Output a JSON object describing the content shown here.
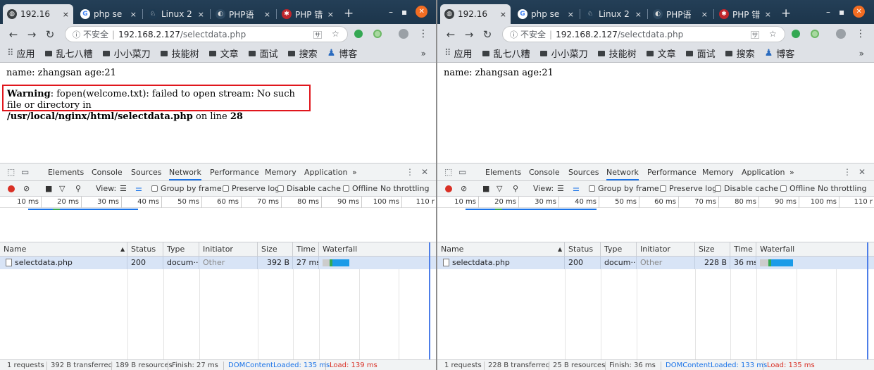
{
  "windows": [
    {
      "tabs": [
        {
          "title": "192.16",
          "close": "×"
        },
        {
          "title": "php se",
          "close": "×"
        },
        {
          "title": "Linux 2",
          "close": "×"
        },
        {
          "title": "PHP语",
          "close": "×"
        },
        {
          "title": "PHP 错",
          "close": "×"
        }
      ],
      "new_tab": "+",
      "url": {
        "insecure": "不安全",
        "host": "192.168.2.127",
        "path": "/selectdata.php"
      },
      "bookmarks": [
        "应用",
        "乱七八糟",
        "小小菜刀",
        "技能树",
        "文章",
        "面试",
        "搜索",
        "博客"
      ],
      "bookmarks_more": "»",
      "page": {
        "name_line": "name: zhangsan age:21",
        "warning": {
          "label": "Warning",
          "message": ": fopen(welcome.txt): failed to open stream: No such file or directory in",
          "path": "/usr/local/nginx/html/selectdata.php",
          "on_line": " on line ",
          "line": "28"
        }
      },
      "devtools": {
        "tabs": [
          "Elements",
          "Console",
          "Sources",
          "Network",
          "Performance",
          "Memory",
          "Application"
        ],
        "active_tab": "Network",
        "more_tabs": "»",
        "controls": {
          "view": "View:",
          "group_by_frame": "Group by frame",
          "preserve_log": "Preserve log",
          "disable_cache": "Disable cache",
          "offline": "Offline",
          "throttling": "No throttling"
        },
        "ruler": [
          "10 ms",
          "20 ms",
          "30 ms",
          "40 ms",
          "50 ms",
          "60 ms",
          "70 ms",
          "80 ms",
          "90 ms",
          "100 ms",
          "110 r"
        ],
        "columns": {
          "name": "Name",
          "status": "Status",
          "type": "Type",
          "initiator": "Initiator",
          "size": "Size",
          "time": "Time",
          "waterfall": "Waterfall"
        },
        "rows": [
          {
            "name": "selectdata.php",
            "status": "200",
            "type": "docum···",
            "initiator": "Other",
            "size": "392 B",
            "time": "27 ms"
          }
        ],
        "footer": {
          "requests": "1 requests",
          "transferred": "392 B transferred",
          "resources": "189 B resources",
          "finish": "Finish: 27 ms",
          "dcl": "DOMContentLoaded: 135 ms",
          "load": "Load: 139 ms"
        }
      }
    },
    {
      "tabs": [
        {
          "title": "192.16",
          "close": "×"
        },
        {
          "title": "php se",
          "close": "×"
        },
        {
          "title": "Linux 2",
          "close": "×"
        },
        {
          "title": "PHP语",
          "close": "×"
        },
        {
          "title": "PHP 错",
          "close": "×"
        }
      ],
      "new_tab": "+",
      "url": {
        "insecure": "不安全",
        "host": "192.168.2.127",
        "path": "/selectdata.php"
      },
      "bookmarks": [
        "应用",
        "乱七八糟",
        "小小菜刀",
        "技能树",
        "文章",
        "面试",
        "搜索",
        "博客"
      ],
      "bookmarks_more": "»",
      "page": {
        "name_line": "name: zhangsan age:21"
      },
      "devtools": {
        "tabs": [
          "Elements",
          "Console",
          "Sources",
          "Network",
          "Performance",
          "Memory",
          "Application"
        ],
        "active_tab": "Network",
        "more_tabs": "»",
        "controls": {
          "view": "View:",
          "group_by_frame": "Group by frame",
          "preserve_log": "Preserve log",
          "disable_cache": "Disable cache",
          "offline": "Offline",
          "throttling": "No throttling"
        },
        "ruler": [
          "10 ms",
          "20 ms",
          "30 ms",
          "40 ms",
          "50 ms",
          "60 ms",
          "70 ms",
          "80 ms",
          "90 ms",
          "100 ms",
          "110 r"
        ],
        "columns": {
          "name": "Name",
          "status": "Status",
          "type": "Type",
          "initiator": "Initiator",
          "size": "Size",
          "time": "Time",
          "waterfall": "Waterfall"
        },
        "rows": [
          {
            "name": "selectdata.php",
            "status": "200",
            "type": "docum···",
            "initiator": "Other",
            "size": "228 B",
            "time": "36 ms"
          }
        ],
        "footer": {
          "requests": "1 requests",
          "transferred": "228 B transferred",
          "resources": "25 B resources",
          "finish": "Finish: 36 ms",
          "dcl": "DOMContentLoaded: 133 ms",
          "load": "Load: 135 ms"
        }
      }
    }
  ],
  "colors": {
    "accent": "#1a73e8",
    "warning_border": "#e0161c",
    "load_red": "#d93025",
    "tabbar": "#1e3a52"
  },
  "icons": [
    "globe-icon",
    "google-icon",
    "linux-icon",
    "php-icon",
    "php-error-icon",
    "back-icon",
    "forward-icon",
    "reload-icon",
    "info-icon",
    "translate-icon",
    "star-icon",
    "shield-icon",
    "extension-icon",
    "profile-icon",
    "menu-icon",
    "apps-icon",
    "folder-icon",
    "blog-icon",
    "inspect-icon",
    "device-icon",
    "record-icon",
    "clear-icon",
    "camera-icon",
    "filter-icon",
    "search-icon",
    "list-view-icon",
    "waterfall-view-icon",
    "close-icon"
  ]
}
